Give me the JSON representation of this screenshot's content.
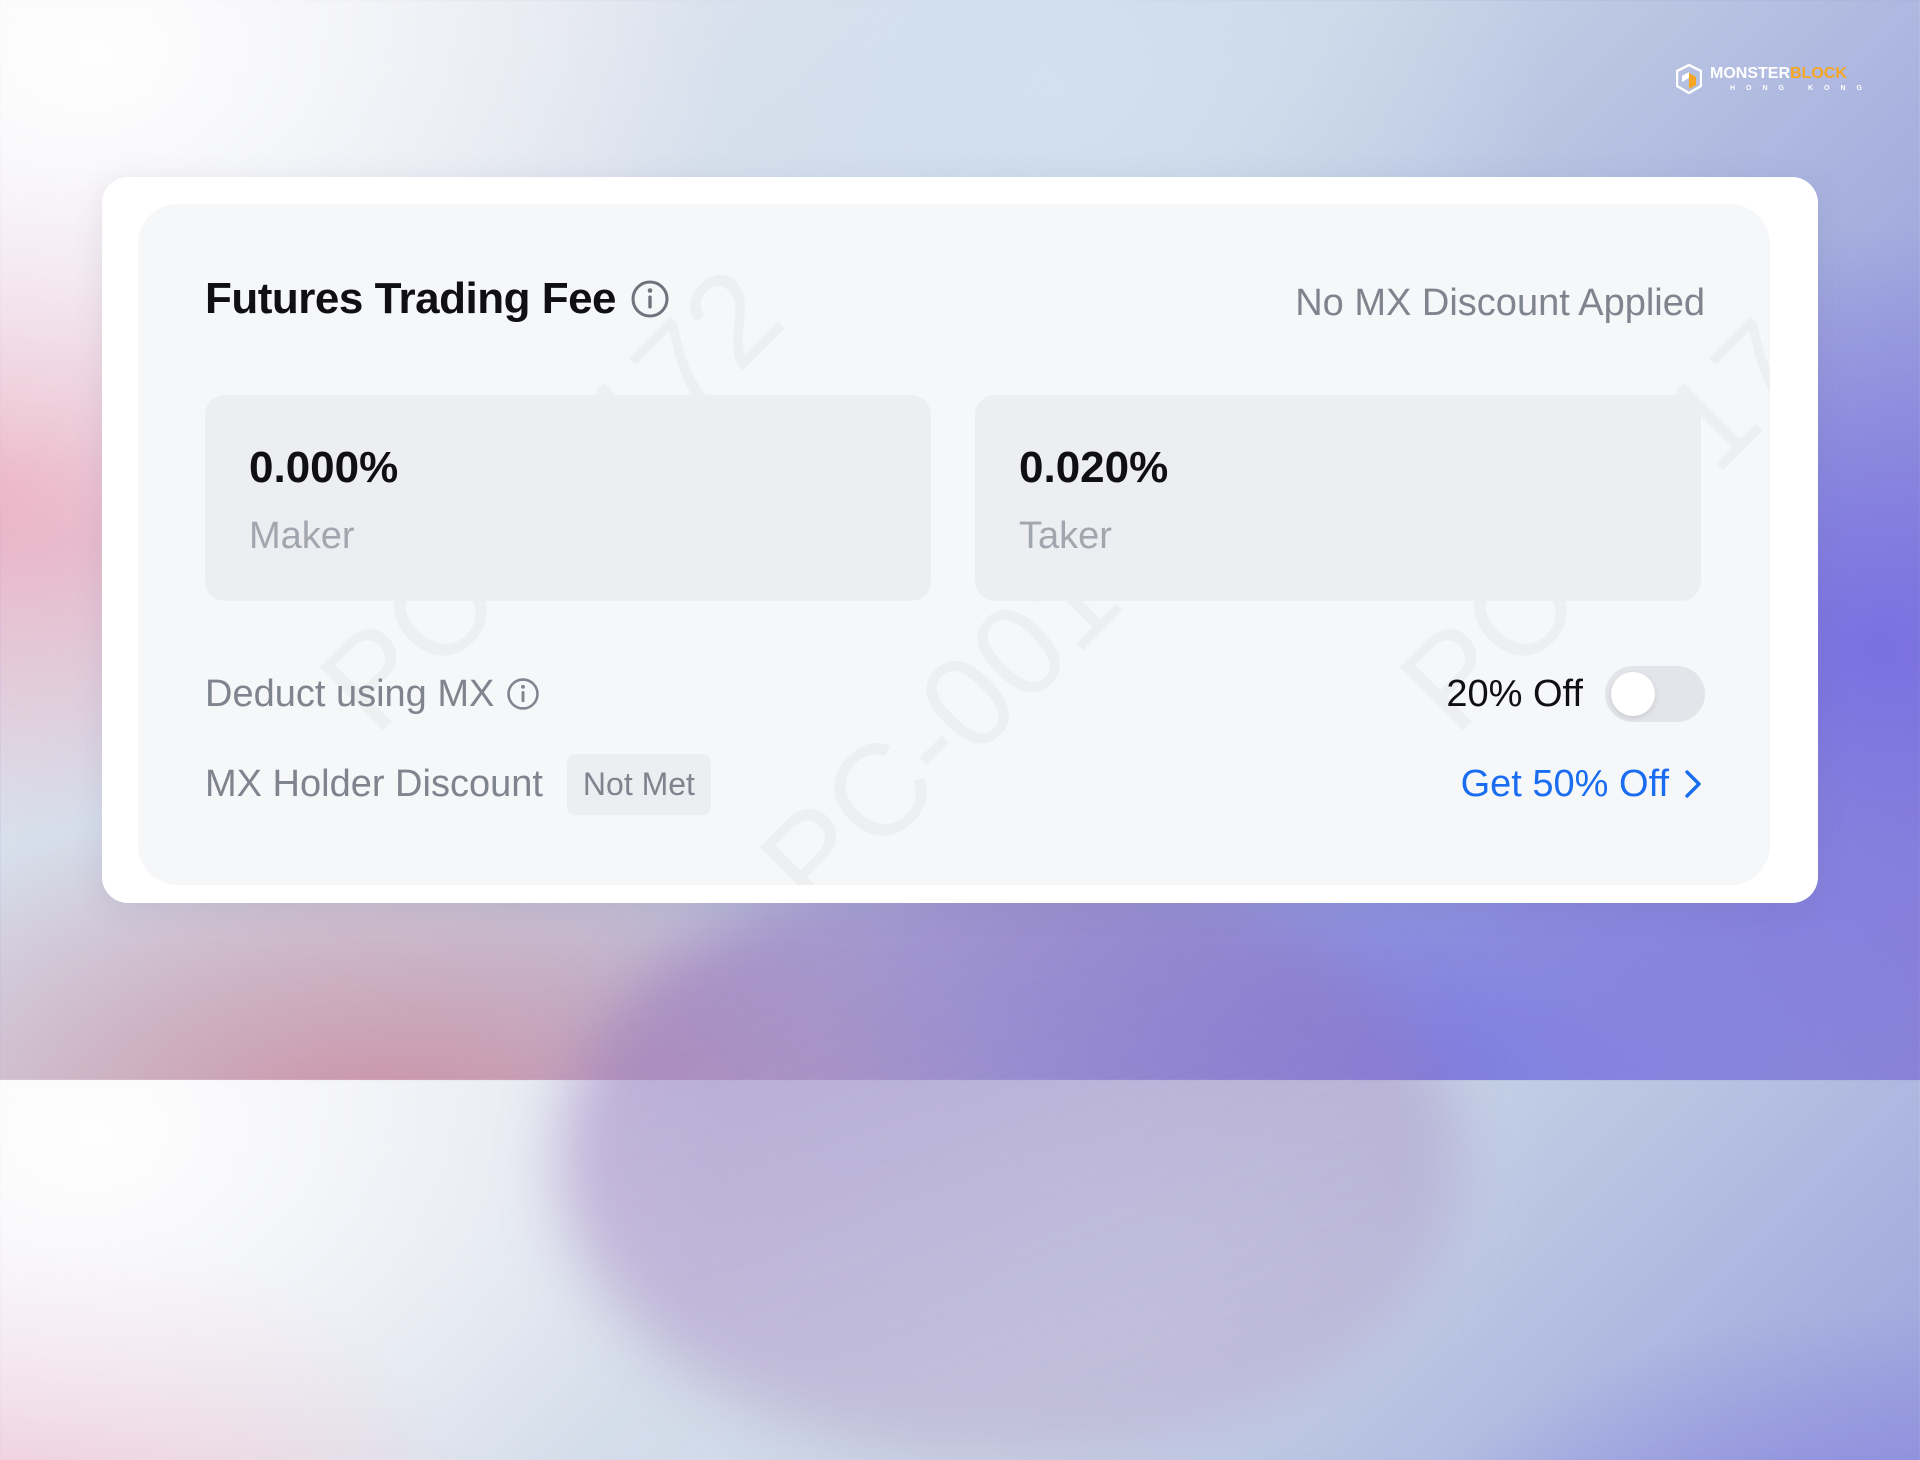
{
  "logo": {
    "word_part1": "MONSTER",
    "word_part2": "BLOCK",
    "sub": "HONG KONG"
  },
  "card": {
    "title": "Futures Trading Fee",
    "discount_status": "No MX Discount Applied",
    "maker": {
      "value": "0.000%",
      "label": "Maker"
    },
    "taker": {
      "value": "0.020%",
      "label": "Taker"
    },
    "deduct": {
      "label": "Deduct using MX",
      "off_label": "20% Off",
      "toggle_on": false
    },
    "holder": {
      "label": "MX Holder Discount",
      "badge": "Not Met",
      "link": "Get 50% Off"
    }
  },
  "colors": {
    "accent": "#1a6cf0",
    "brand_orange": "#f6a623",
    "muted_text": "#80848e"
  },
  "icons": [
    "info-icon",
    "chevron-right-icon",
    "monsterblock-logo"
  ]
}
